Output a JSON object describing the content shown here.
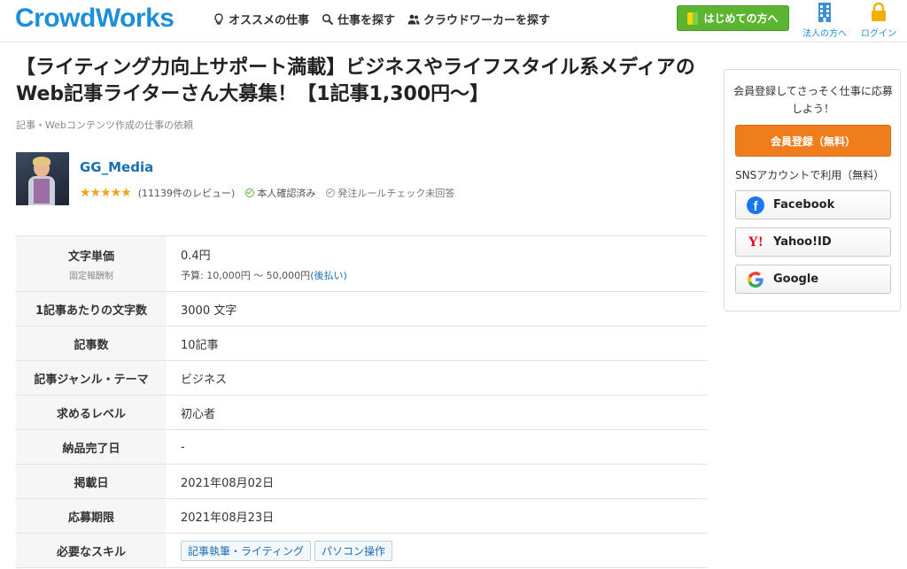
{
  "header": {
    "logo": "CrowdWorks",
    "nav": [
      {
        "label": "オススメの仕事",
        "icon": "lightbulb-icon"
      },
      {
        "label": "仕事を探す",
        "icon": "search-icon"
      },
      {
        "label": "クラウドワーカーを探す",
        "icon": "users-icon"
      }
    ],
    "start_button": "はじめての方へ",
    "corporate_link": "法人の方へ",
    "login_link": "ログイン"
  },
  "job": {
    "title": "【ライティング力向上サポート満載】ビジネスやライフスタイル系メディアのWeb記事ライターさん大募集！【1記事1,300円〜】",
    "category": "記事・Webコンテンツ作成の仕事の依頼"
  },
  "client": {
    "name": "GG_Media",
    "rating": 5,
    "stars": "★★★★★",
    "reviews": "(11139件のレビュー)",
    "identity": "本人確認済み",
    "rule_check": "発注ルールチェック未回答"
  },
  "details": {
    "unit_price_label": "文字単価",
    "unit_price_sub": "固定報酬制",
    "unit_price_value": "0.4円",
    "budget": "予算: 10,000円 〜 50,000円",
    "budget_payment": "(後払い)",
    "rows": [
      {
        "label": "1記事あたりの文字数",
        "value": "3000 文字"
      },
      {
        "label": "記事数",
        "value": "10記事"
      },
      {
        "label": "記事ジャンル・テーマ",
        "value": "ビジネス"
      },
      {
        "label": "求めるレベル",
        "value": "初心者"
      },
      {
        "label": "納品完了日",
        "value": "-"
      },
      {
        "label": "掲載日",
        "value": "2021年08月02日"
      },
      {
        "label": "応募期限",
        "value": "2021年08月23日"
      }
    ],
    "skills_label": "必要なスキル",
    "skills": [
      "記事執筆・ライティング",
      "パソコン操作"
    ]
  },
  "sidebar": {
    "message": "会員登録してさっそく仕事に応募しよう！",
    "register_button": "会員登録（無料）",
    "sns_label": "SNSアカウントで利用（無料）",
    "facebook": "Facebook",
    "yahoo": "Yahoo!ID",
    "google": "Google"
  },
  "colors": {
    "brand": "#1d8fd8",
    "start_button": "#5cb531",
    "register_button": "#f07d1b",
    "star": "#f2a21b"
  }
}
